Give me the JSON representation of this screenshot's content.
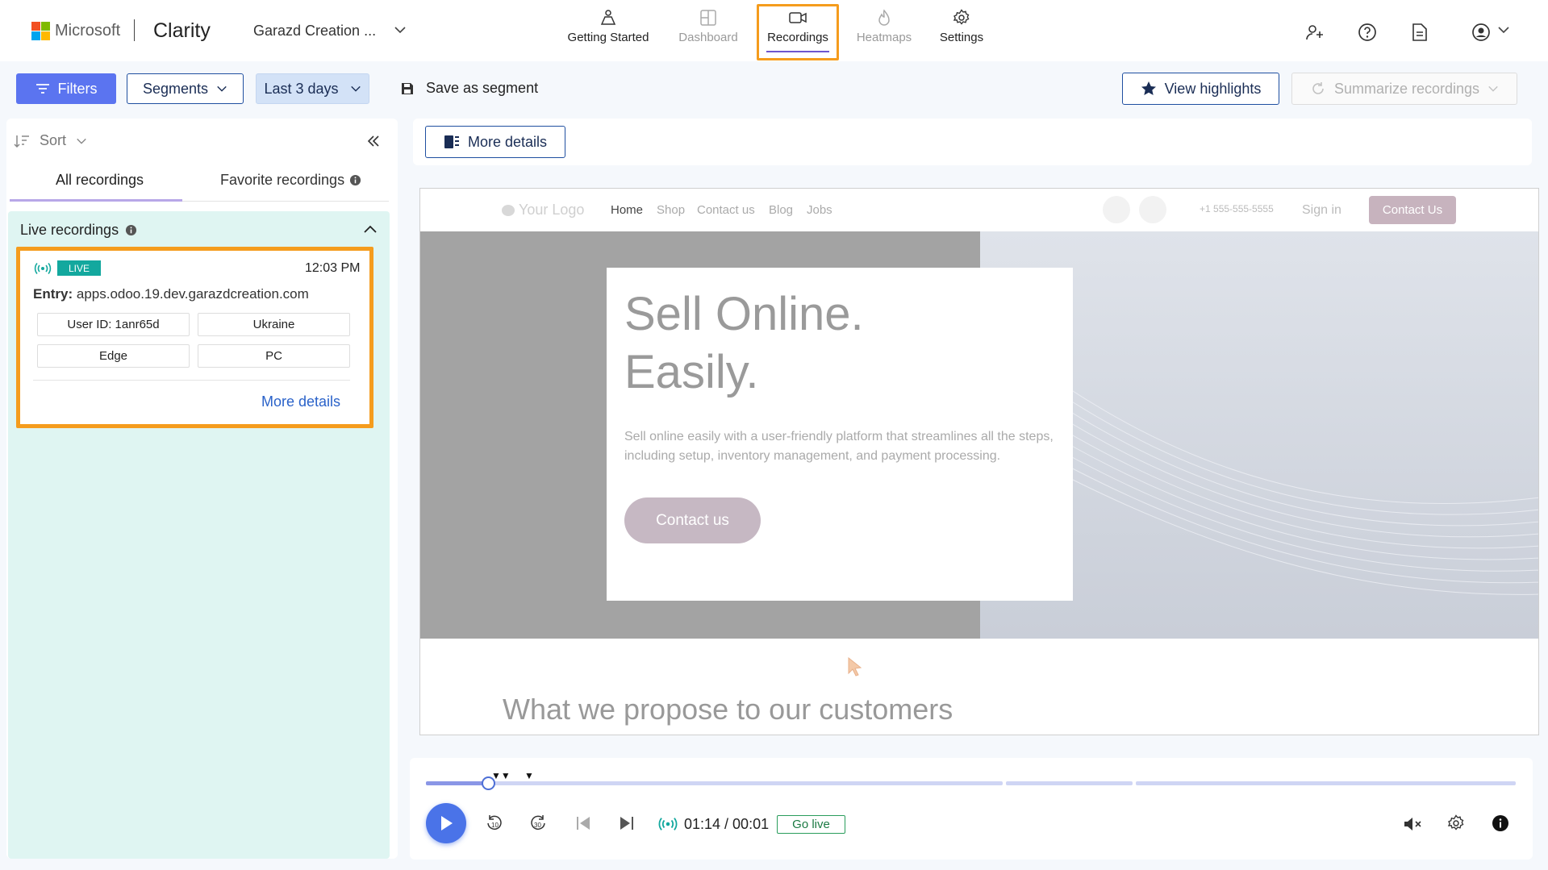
{
  "header": {
    "brand": "Microsoft",
    "app_name": "Clarity",
    "project": "Garazd Creation ...",
    "nav": [
      {
        "label": "Getting Started",
        "icon": "getting-started-icon",
        "active": false
      },
      {
        "label": "Dashboard",
        "icon": "dashboard-icon",
        "active": false
      },
      {
        "label": "Recordings",
        "icon": "recordings-icon",
        "active": true
      },
      {
        "label": "Heatmaps",
        "icon": "heatmaps-icon",
        "active": false
      },
      {
        "label": "Settings",
        "icon": "settings-icon",
        "active": false
      }
    ],
    "right_icons": [
      "share-icon",
      "help-icon",
      "document-icon",
      "account-icon"
    ]
  },
  "toolbar": {
    "filters": "Filters",
    "segments": "Segments",
    "date_range": "Last 3 days",
    "save_segment": "Save as segment",
    "view_highlights": "View highlights",
    "summarize": "Summarize recordings"
  },
  "sidebar": {
    "sort": "Sort",
    "tabs": [
      "All recordings",
      "Favorite recordings"
    ],
    "live_section": "Live recordings",
    "card": {
      "badge": "LIVE",
      "time": "12:03 PM",
      "entry_label": "Entry:",
      "entry_url": "apps.odoo.19.dev.garazdcreation.com",
      "chips": [
        "User ID: 1anr65d",
        "Ukraine",
        "Edge",
        "PC"
      ],
      "more": "More details"
    }
  },
  "main": {
    "more_details": "More details"
  },
  "replay": {
    "logo": "Your Logo",
    "nav": [
      "Home",
      "Shop",
      "Contact us",
      "Blog",
      "Jobs"
    ],
    "phone": "+1 555-555-5555",
    "sign_in": "Sign in",
    "contact_btn": "Contact Us",
    "hero_title_1": "Sell Online.",
    "hero_title_2": "Easily.",
    "hero_text": "Sell online easily with a user-friendly platform that streamlines all the steps, including setup, inventory management, and payment processing.",
    "hero_button": "Contact us",
    "section_title": "What we propose to our customers"
  },
  "player": {
    "time": "01:14 / 00:01",
    "go_live": "Go live",
    "progress": 0.065,
    "colors": {
      "accent": "#4a73e8",
      "live": "#13a89e",
      "highlight": "#f59c1d"
    }
  }
}
